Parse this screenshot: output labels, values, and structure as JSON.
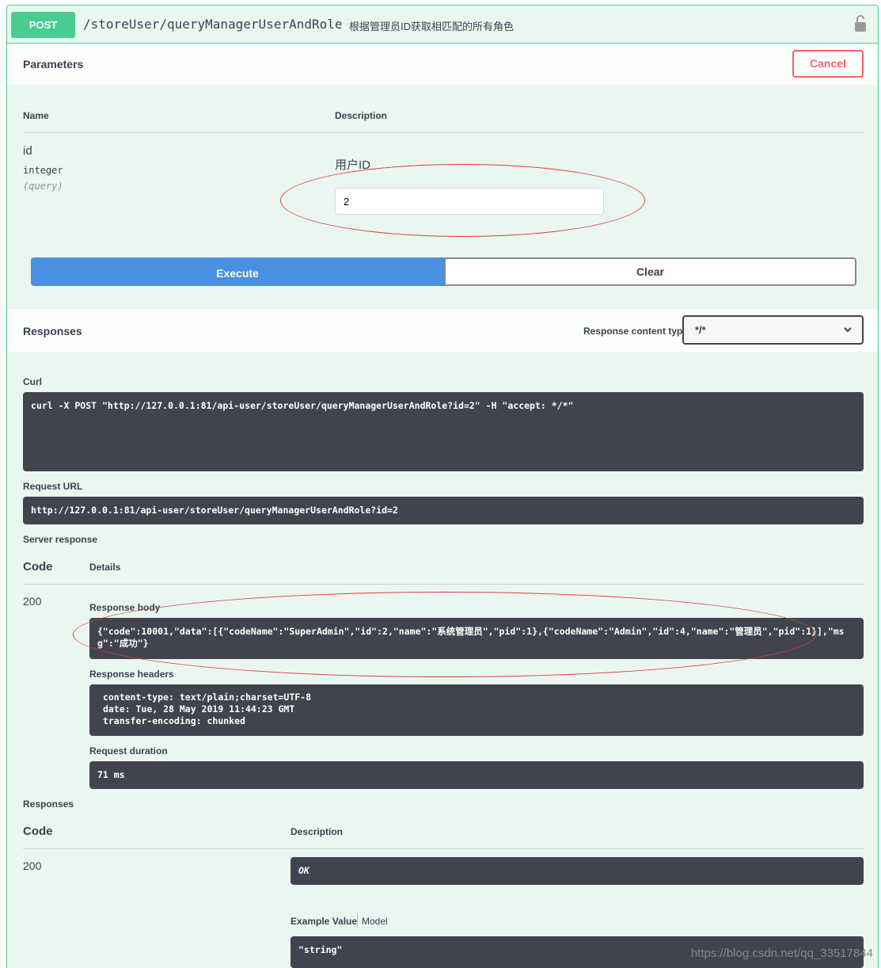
{
  "operation": {
    "method": "POST",
    "path": "/storeUser/queryManagerUserAndRole",
    "description": "根据管理员ID获取相匹配的所有角色"
  },
  "parameters": {
    "title": "Parameters",
    "cancel_label": "Cancel",
    "col_name": "Name",
    "col_description": "Description",
    "items": [
      {
        "name": "id",
        "type": "integer",
        "in": "(query)",
        "description": "用户ID",
        "value": "2"
      }
    ]
  },
  "actions": {
    "execute_label": "Execute",
    "clear_label": "Clear"
  },
  "responses_header": {
    "title": "Responses",
    "content_type_label": "Response content type",
    "content_type_value": "*/*"
  },
  "curl": {
    "label": "Curl",
    "command": "curl -X POST \"http://127.0.0.1:81/api-user/storeUser/queryManagerUserAndRole?id=2\" -H \"accept: */*\""
  },
  "request_url": {
    "label": "Request URL",
    "value": "http://127.0.0.1:81/api-user/storeUser/queryManagerUserAndRole?id=2"
  },
  "server_response": {
    "label": "Server response",
    "col_code": "Code",
    "col_details": "Details",
    "code": "200",
    "body_label": "Response body",
    "body": "{\"code\":10001,\"data\":[{\"codeName\":\"SuperAdmin\",\"id\":2,\"name\":\"系统管理员\",\"pid\":1},{\"codeName\":\"Admin\",\"id\":4,\"name\":\"管理员\",\"pid\":1}],\"msg\":\"成功\"}",
    "headers_label": "Response headers",
    "headers": " content-type: text/plain;charset=UTF-8 \n date: Tue, 28 May 2019 11:44:23 GMT \n transfer-encoding: chunked ",
    "duration_label": "Request duration",
    "duration": "71 ms"
  },
  "responses": {
    "label": "Responses",
    "col_code": "Code",
    "col_description": "Description",
    "code": "200",
    "description": "OK",
    "example_tab": "Example Value",
    "model_tab": "Model",
    "example": "\"string\""
  },
  "watermark": "https://blog.csdn.net/qq_33517844",
  "colors": {
    "post": "#49cc90",
    "execute": "#4990e2",
    "cancel": "#ff6060",
    "code_bg": "#41444e",
    "annotation": "#e33a3a"
  }
}
